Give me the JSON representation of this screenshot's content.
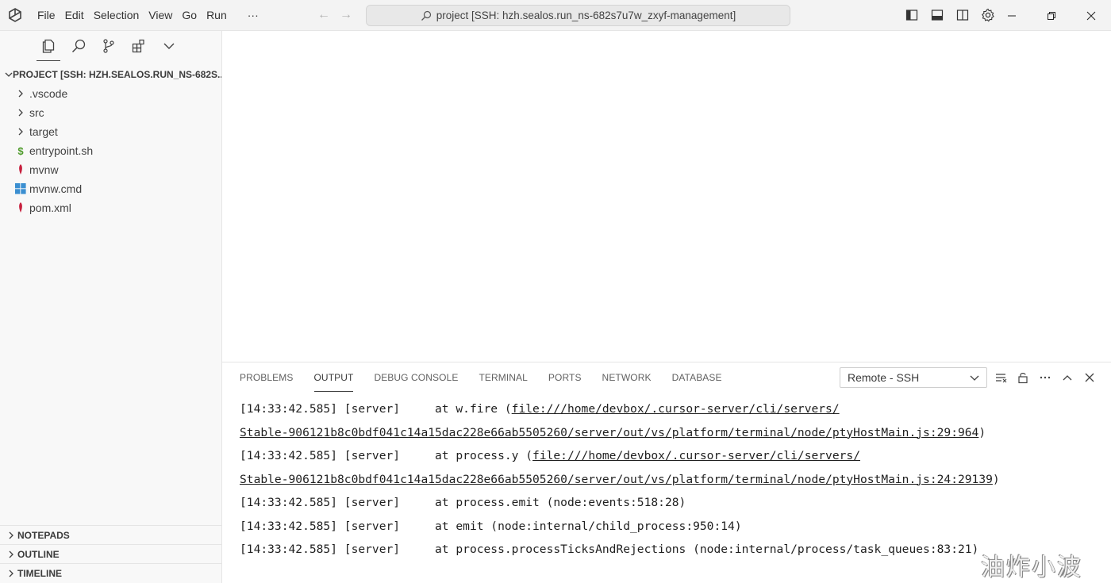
{
  "menu": [
    "File",
    "Edit",
    "Selection",
    "View",
    "Go",
    "Run",
    "···"
  ],
  "command_center": "project [SSH: hzh.sealos.run_ns-682s7u7w_zxyf-management]",
  "explorer": {
    "project_header": "PROJECT [SSH: HZH.SEALOS.RUN_NS-682S...",
    "items": [
      {
        "label": ".vscode",
        "kind": "folder"
      },
      {
        "label": "src",
        "kind": "folder"
      },
      {
        "label": "target",
        "kind": "folder"
      },
      {
        "label": "entrypoint.sh",
        "kind": "shell",
        "icon": "dollar-icon"
      },
      {
        "label": "mvnw",
        "kind": "file",
        "icon": "maven-icon"
      },
      {
        "label": "mvnw.cmd",
        "kind": "file",
        "icon": "windows-icon"
      },
      {
        "label": "pom.xml",
        "kind": "file",
        "icon": "maven-icon"
      }
    ],
    "bottom_sections": [
      "NOTEPADS",
      "OUTLINE",
      "TIMELINE"
    ]
  },
  "panel": {
    "tabs": [
      "PROBLEMS",
      "OUTPUT",
      "DEBUG CONSOLE",
      "TERMINAL",
      "PORTS",
      "NETWORK",
      "DATABASE"
    ],
    "active_tab": "OUTPUT",
    "output_channel": "Remote - SSH",
    "lines": [
      {
        "prefix": "[14:33:42.585] [server]     at w.fire (",
        "link": "file:///home/devbox/.cursor-server/cli/servers/",
        "suffix": ""
      },
      {
        "prefix": "",
        "link": "Stable-906121b8c0bdf041c14a15dac228e66ab5505260/server/out/vs/platform/terminal/node/ptyHostMain.js:29:964",
        "suffix": ")"
      },
      {
        "prefix": "[14:33:42.585] [server]     at process.y (",
        "link": "file:///home/devbox/.cursor-server/cli/servers/",
        "suffix": ""
      },
      {
        "prefix": "",
        "link": "Stable-906121b8c0bdf041c14a15dac228e66ab5505260/server/out/vs/platform/terminal/node/ptyHostMain.js:24:29139",
        "suffix": ")"
      },
      {
        "prefix": "[14:33:42.585] [server]     at process.emit (node:events:518:28)",
        "link": "",
        "suffix": ""
      },
      {
        "prefix": "[14:33:42.585] [server]     at emit (node:internal/child_process:950:14)",
        "link": "",
        "suffix": ""
      },
      {
        "prefix": "[14:33:42.585] [server]     at process.processTicksAndRejections (node:internal/process/task_queues:83:21)",
        "link": "",
        "suffix": ""
      }
    ]
  },
  "watermark": "油炸小波"
}
